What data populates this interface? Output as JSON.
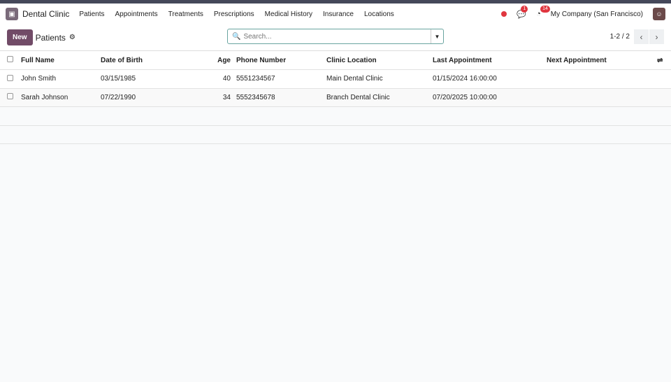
{
  "app": {
    "name": "Dental Clinic",
    "menu": [
      "Patients",
      "Appointments",
      "Treatments",
      "Prescriptions",
      "Medical History",
      "Insurance",
      "Locations"
    ],
    "messages_count": "1",
    "activities_count": "14",
    "company": "My Company (San Francisco)"
  },
  "control": {
    "new_label": "New",
    "title": "Patients",
    "search_placeholder": "Search...",
    "pager": "1-2 / 2"
  },
  "table": {
    "headers": [
      "Full Name",
      "Date of Birth",
      "Age",
      "Phone Number",
      "Clinic Location",
      "Last Appointment",
      "Next Appointment"
    ],
    "rows": [
      [
        "John Smith",
        "03/15/1985",
        "40",
        "5551234567",
        "Main Dental Clinic",
        "01/15/2024 16:00:00",
        ""
      ],
      [
        "Sarah Johnson",
        "07/22/1990",
        "34",
        "5552345678",
        "Branch Dental Clinic",
        "07/20/2025 10:00:00",
        ""
      ]
    ]
  }
}
